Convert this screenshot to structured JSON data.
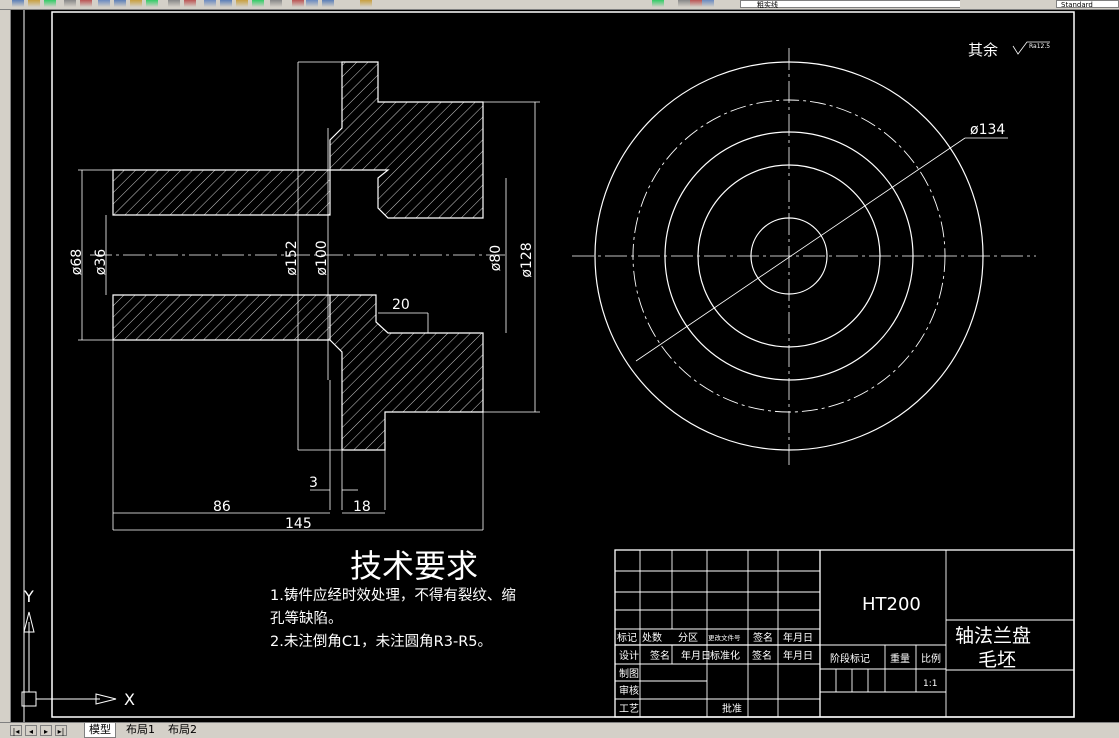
{
  "toolbar": {
    "layer_name": "粗实线",
    "text_style": "Standard",
    "icons": [
      "new-icon",
      "open-icon",
      "save-icon",
      "print-icon",
      "preview-icon",
      "cut-icon",
      "copy-icon",
      "paste-icon",
      "match-icon",
      "undo-icon",
      "redo-icon",
      "pan-icon",
      "zoom-icon",
      "zoom-window-icon",
      "zoom-previous-icon",
      "properties-icon",
      "design-center-icon",
      "tool-palette-icon",
      "help-icon",
      "layer-icon",
      "light-icon",
      "sun-icon",
      "lock-icon",
      "color-icon"
    ]
  },
  "drawing": {
    "roughness_label": "其余",
    "roughness_value": "Ra12.5",
    "dims": {
      "d68": "ø68",
      "d36": "ø36",
      "d152": "ø152",
      "d100": "ø100",
      "d80": "ø80",
      "d128": "ø128",
      "dim20": "20",
      "dim3": "3",
      "dim86": "86",
      "dim18": "18",
      "dim145": "145",
      "d134": "ø134"
    },
    "tech_title": "技术要求",
    "tech_line1": "1.铸件应经时效处理，不得有裂纹、缩",
    "tech_line2": "孔等缺陷。",
    "tech_line3": "2.未注倒角C1，未注圆角R3-R5。",
    "ucs_x": "X",
    "ucs_y": "Y"
  },
  "title_block": {
    "material": "HT200",
    "part_name_1": "轴法兰盘",
    "part_name_2": "毛坯",
    "c_biaoji": "标记",
    "c_chushu": "处数",
    "c_fenqu": "分区",
    "c_genggai": "更改文件号",
    "c_qianming": "签名",
    "c_nianyueri": "年月日",
    "c_sheji": "设计",
    "c_qianming2": "签名",
    "c_nianyueri2": "年月日",
    "c_biaozhunhua": "标准化",
    "c_qianming3": "签名",
    "c_nianyueri3": "年月日",
    "c_zhitu": "制图",
    "c_shenhe": "审核",
    "c_gongyi": "工艺",
    "c_pizhun": "批准",
    "c_jieduan": "阶段标记",
    "c_zhongliang": "重量",
    "c_bili": "比例",
    "scale": "1:1"
  },
  "tabs": {
    "model": "模型",
    "layout1": "布局1",
    "layout2": "布局2",
    "nav": [
      "|◂",
      "◂",
      "▸",
      "▸|"
    ]
  },
  "colors": {
    "background": "#000000",
    "lines": "#ffffff",
    "ui": "#d4d0c8"
  }
}
